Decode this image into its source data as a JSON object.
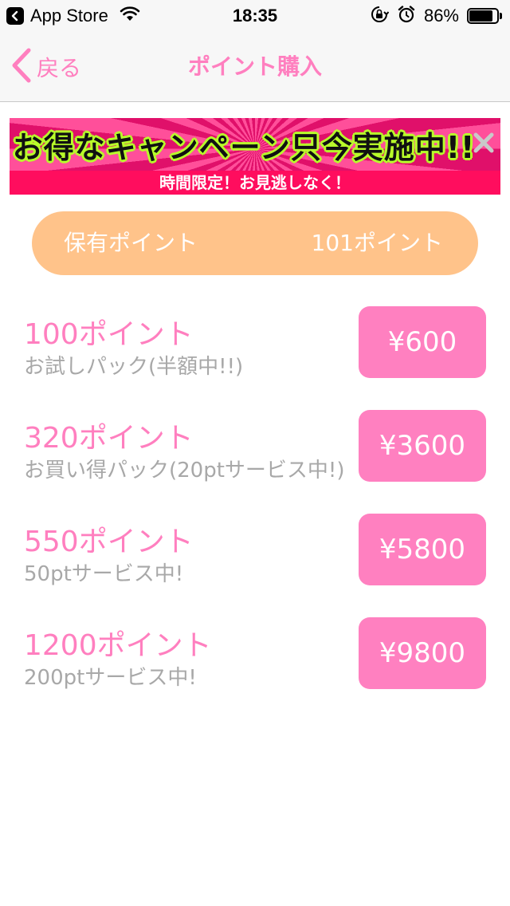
{
  "status_bar": {
    "back_app": "App Store",
    "time": "18:35",
    "battery_percent": "86%",
    "battery_level": 0.86
  },
  "nav": {
    "back_label": "戻る",
    "title": "ポイント購入"
  },
  "banner": {
    "headline": "お得なキャンペーン只今実施中!!",
    "subline": "時間限定！お見逃しなく！"
  },
  "points": {
    "label": "保有ポイント",
    "value": "101ポイント"
  },
  "products": [
    {
      "name": "100ポイント",
      "desc": "お試しパック(半額中!!)",
      "price": "¥600"
    },
    {
      "name": "320ポイント",
      "desc": "お買い得パック(20ptサービス中!)",
      "price": "¥3600"
    },
    {
      "name": "550ポイント",
      "desc": "50ptサービス中!",
      "price": "¥5800"
    },
    {
      "name": "1200ポイント",
      "desc": "200ptサービス中!",
      "price": "¥9800"
    }
  ],
  "colors": {
    "accent_pink": "#ff7fbf",
    "button_pink": "#ff80c0",
    "points_pill": "#ffc38a",
    "banner_red": "#ff0d5e",
    "banner_green": "#b8ff2a",
    "desc_gray": "#a8a8a8"
  },
  "icons": {
    "back_app": "chevron-left-icon",
    "wifi": "wifi-icon",
    "orientation_lock": "orientation-lock-icon",
    "alarm": "alarm-icon",
    "battery": "battery-icon",
    "nav_back": "chevron-left-icon",
    "banner_close": "close-icon"
  }
}
